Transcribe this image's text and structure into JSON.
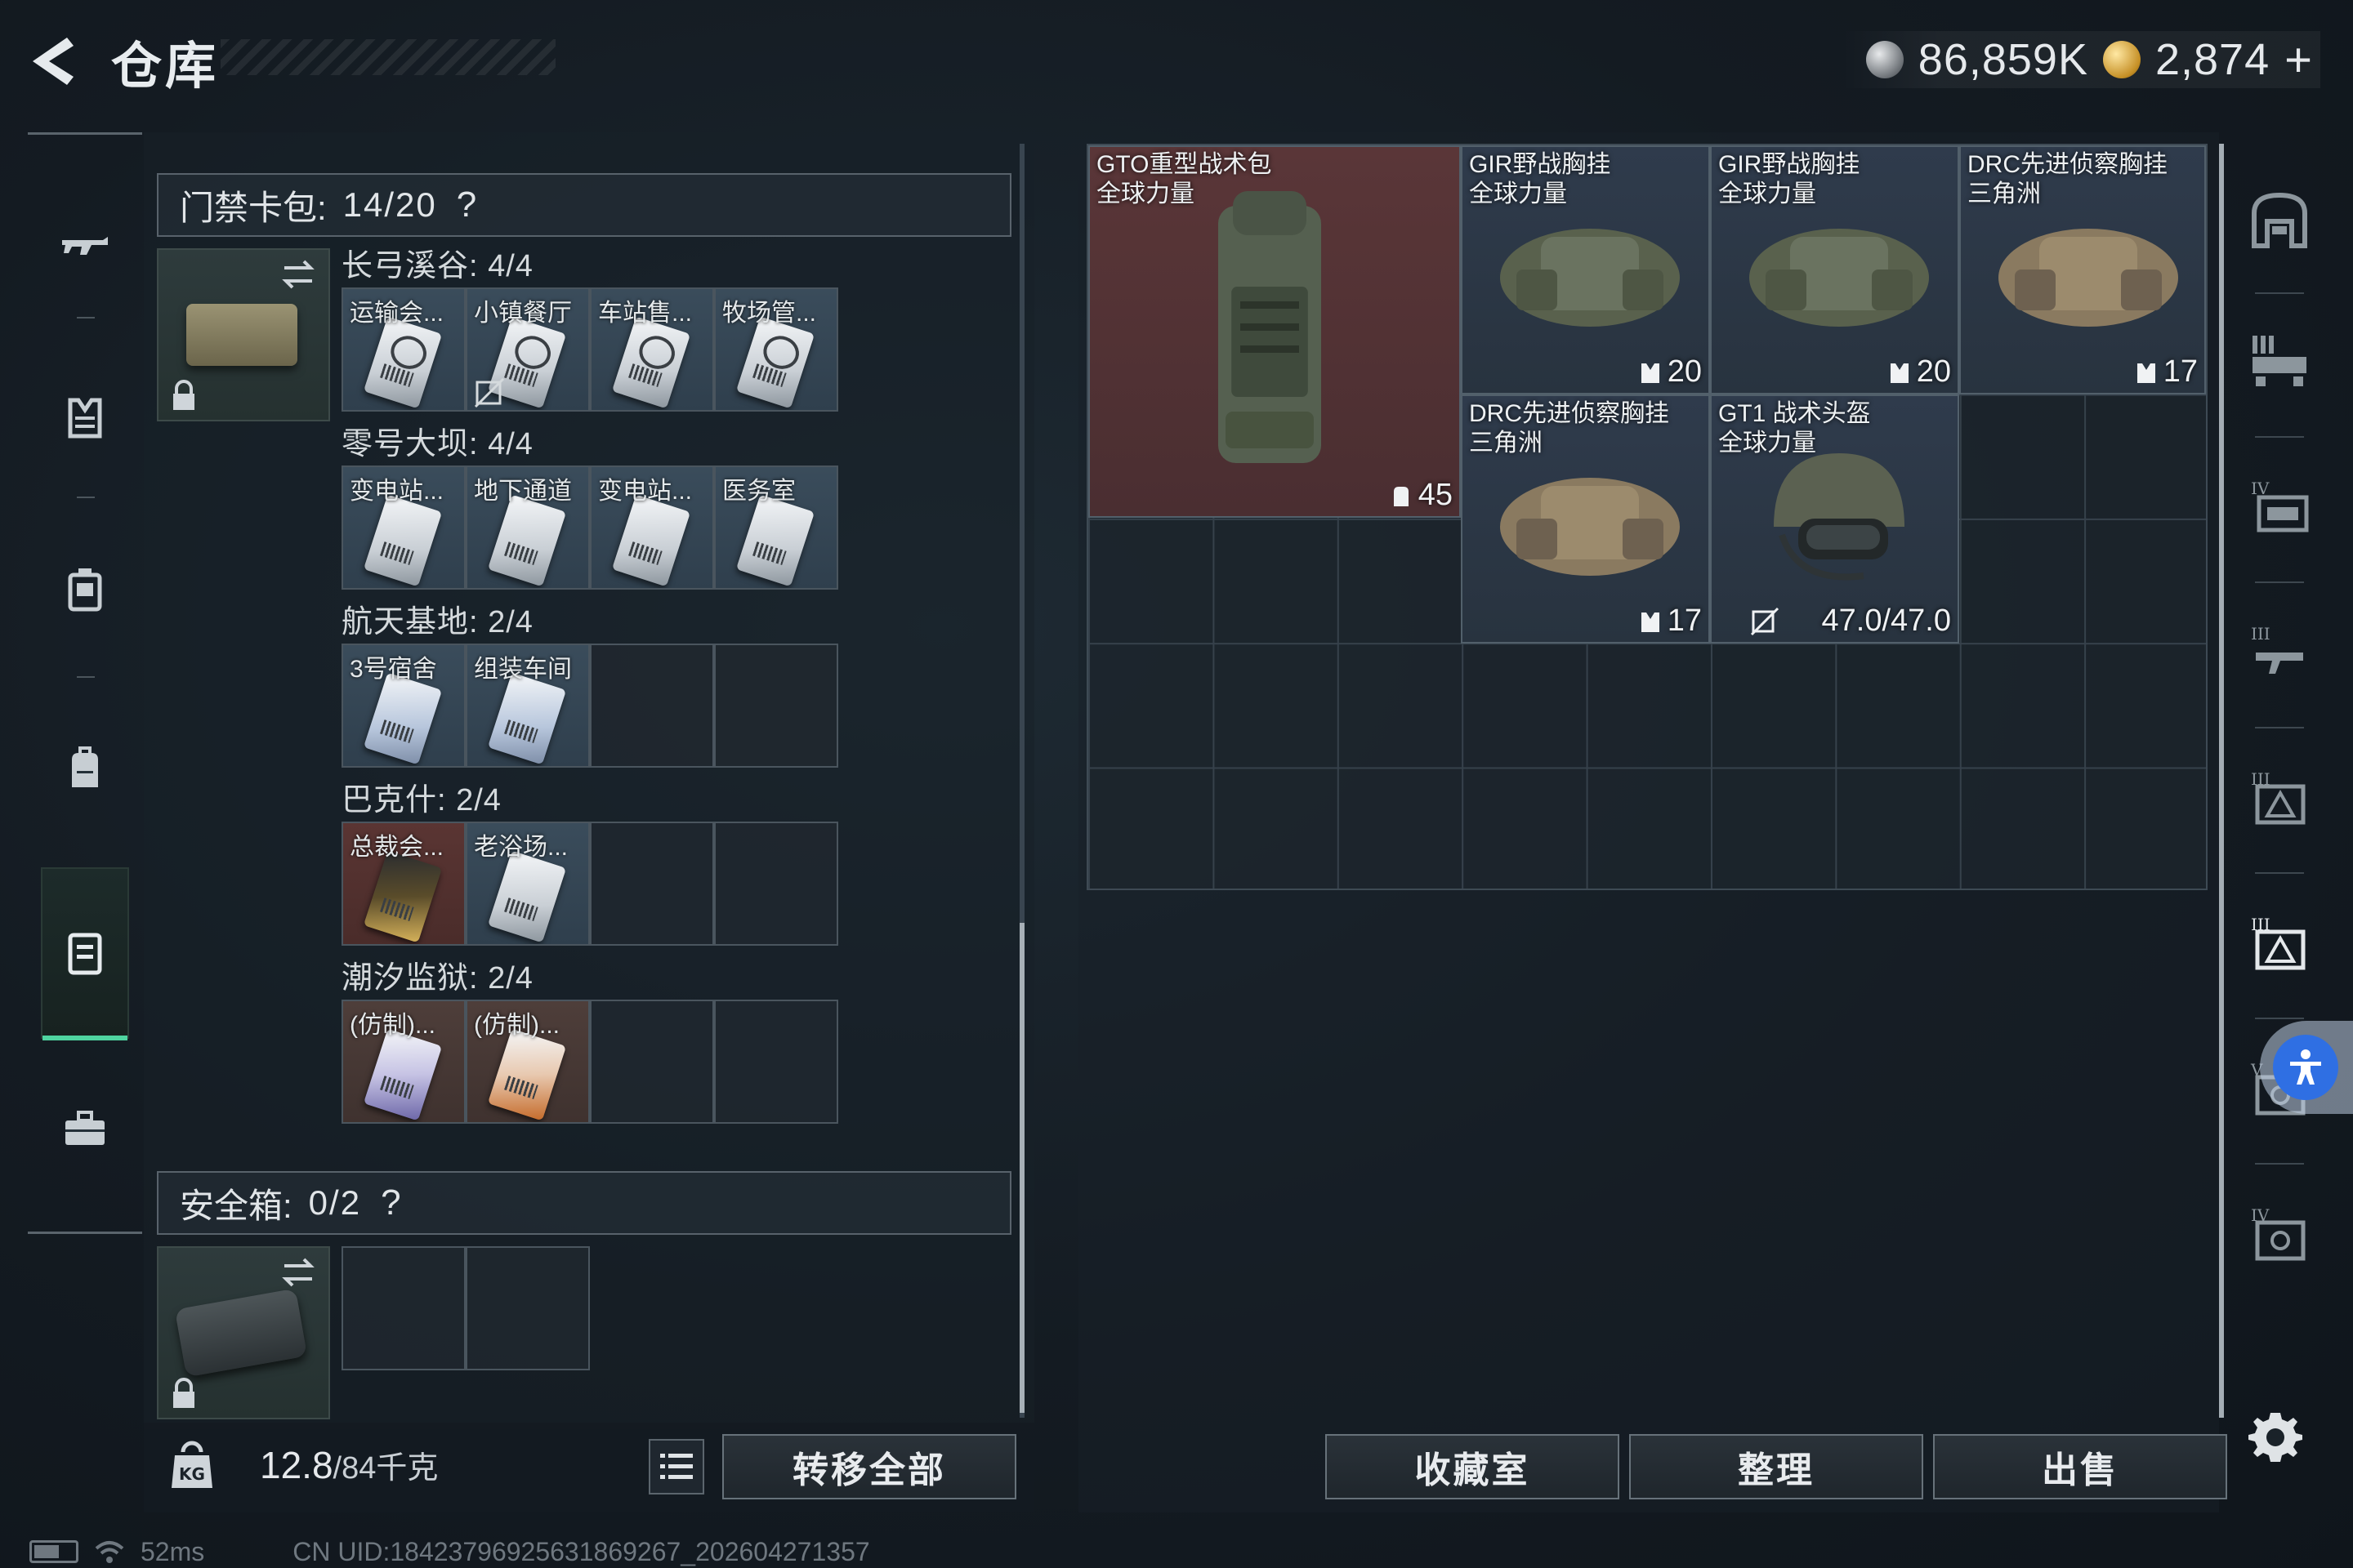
{
  "header": {
    "title": "仓库",
    "currency_silver": "86,859K",
    "currency_gold": "2,874",
    "plus": "+"
  },
  "left_nav": {
    "items": [
      {
        "icon": "rifle-icon"
      },
      {
        "icon": "armor-icon"
      },
      {
        "icon": "chest-rig-icon"
      },
      {
        "icon": "backpack-icon"
      },
      {
        "icon": "keycard-case-icon",
        "active": true
      },
      {
        "icon": "briefcase-icon"
      }
    ]
  },
  "keycard_pack": {
    "label": "门禁卡包:",
    "value": "14/20",
    "help": "?"
  },
  "groups": [
    {
      "title": "长弓溪谷: 4/4",
      "cards": [
        "运输会...",
        "小镇餐厅",
        "车站售...",
        "牧场管..."
      ]
    },
    {
      "title": "零号大坝: 4/4",
      "cards": [
        "变电站...",
        "地下通道",
        "变电站...",
        "医务室"
      ]
    },
    {
      "title": "航天基地: 2/4",
      "cards": [
        "3号宿舍",
        "组装车间"
      ]
    },
    {
      "title": "巴克什: 2/4",
      "cards": [
        "总裁会...",
        "老浴场..."
      ]
    },
    {
      "title": "潮汐监狱: 2/4",
      "cards": [
        "(仿制)...",
        "(仿制)..."
      ]
    }
  ],
  "safe_box": {
    "label": "安全箱:",
    "value": "0/2",
    "help": "?"
  },
  "weight": {
    "current": "12.8",
    "max": "/84千克"
  },
  "buttons": {
    "transfer_all": "转移全部",
    "collection": "收藏室",
    "organize": "整理",
    "sell": "出售"
  },
  "stash_items": [
    {
      "name1": "GTO重型战术包",
      "name2": "全球力量",
      "stat": "45",
      "stat_icon": "backpack-capacity-icon",
      "rarity_color": "#5a3638"
    },
    {
      "name1": "GIR野战胸挂",
      "name2": "全球力量",
      "stat": "20",
      "stat_icon": "rig-capacity-icon",
      "rarity_color": "#2f3b4c"
    },
    {
      "name1": "GIR野战胸挂",
      "name2": "全球力量",
      "stat": "20",
      "stat_icon": "rig-capacity-icon",
      "rarity_color": "#2f3b4c"
    },
    {
      "name1": "DRC先进侦察胸挂",
      "name2": "三角洲",
      "stat": "17",
      "stat_icon": "rig-capacity-icon",
      "rarity_color": "#2f3b4c"
    },
    {
      "name1": "DRC先进侦察胸挂",
      "name2": "三角洲",
      "stat": "17",
      "stat_icon": "rig-capacity-icon",
      "rarity_color": "#2f3b4c"
    },
    {
      "name1": "GT1 战术头盔",
      "name2": "全球力量",
      "stat": "47.0/47.0",
      "stat_icon": "no-trade-icon",
      "rarity_color": "#2f3b4c"
    }
  ],
  "right_nav": {
    "items": [
      "storage-icon",
      "tier-3-gun-rack-icon",
      "tier-4-case-icon",
      "tier-3-rifle-icon",
      "tier-3-armor-icon",
      "tier-3-armor-selected-icon",
      "tier-5-safe-icon",
      "tier-4-safe-icon"
    ]
  },
  "status": {
    "ping": "52ms",
    "uid": "CN UID:18423796925631869267_202604271357"
  }
}
